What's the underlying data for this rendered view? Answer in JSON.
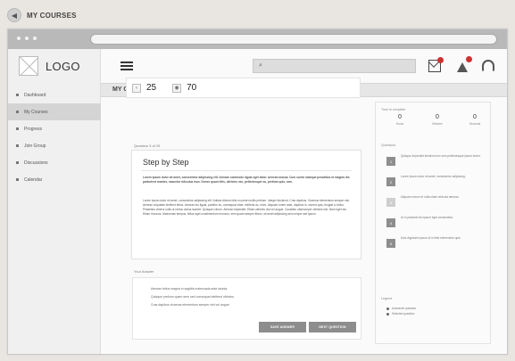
{
  "page": {
    "title": "MY COURSES"
  },
  "sidebar": {
    "logo": "LOGO",
    "items": [
      {
        "label": "Dashboard",
        "active": false
      },
      {
        "label": "My Courses",
        "active": true
      },
      {
        "label": "Progress",
        "active": false
      },
      {
        "label": "Join Group",
        "active": false
      },
      {
        "label": "Discussions",
        "active": false
      },
      {
        "label": "Calendar",
        "active": false
      }
    ]
  },
  "header": {
    "search_icon": "search-icon",
    "icons": [
      "mail-icon",
      "alert-icon",
      "headset-icon"
    ]
  },
  "section": {
    "title": "MY COURSES"
  },
  "stats": {
    "count": "25",
    "views": "70"
  },
  "question": {
    "label": "Question 3 of 25",
    "title": "Step by Step",
    "para1": "Lorem ipsum dolor sit amet, consectetur adipiscing elit. Aenean commodo ligula eget dolor. Aenean massa. Cum sociis natoque penatibus et magnis dis parturient montes, nascetur ridiculus mus. Donec quam felis, ultricies nec, pellentesque eu, pretium quis, sem.",
    "para2": "Lorem ipsum dolor sit amet, consectetur adipiscing elit. Nullam dictum felis eu pede mollis pretium. Integer tincidunt. Cras dapibus. Vivamus elementum semper nisi. Aenean vulputate eleifend tellus. Aenean leo ligula, porttitor eu, consequat vitae, eleifend ac, enim. Aliquam lorem ante, dapibus in, viverra quis, feugiat a, tellus. Phasellus viverra nulla ut metus varius laoreet. Quisque rutrum. Aenean imperdiet. Etiam ultricies nisi vel augue. Curabitur ullamcorper ultricies nisi. Nam eget dui. Etiam rhoncus. Maecenas tempus, tellus eget condimentum rhoncus, sem quam semper libero, sit amet adipiscing sem neque sed ipsum."
  },
  "answer": {
    "label": "Your Answer",
    "lines": [
      "Aenean tellus magna in sagittis malesuada ante lacinia.",
      "Quisque pretium quam sem sed consequat eleifend ultricies.",
      "Cras dapibus vivamus elementum semper nisi vel augue."
    ],
    "save_label": "SAVE ANSWER",
    "next_label": "NEXT QUESTION"
  },
  "right_panel": {
    "header": "Time to complete",
    "counters": [
      {
        "num": "0",
        "label": "Hours"
      },
      {
        "num": "0",
        "label": "Minutes"
      },
      {
        "num": "0",
        "label": "Seconds"
      }
    ],
    "questions_label": "Questions",
    "questions": [
      {
        "num": "1",
        "text": "Quisque imperdiet tincidunt nec sem pellentesque ipsum lorem.",
        "done": true
      },
      {
        "num": "2",
        "text": "Lorem ipsum dolor sit amet, consectetur adipiscing.",
        "done": true
      },
      {
        "num": "3",
        "text": "Aliquam rutrum et nulla vitae vehicula aenean.",
        "done": false
      },
      {
        "num": "4",
        "text": "Ut in placerat nisi ipsum eget consectetur.",
        "done": true
      },
      {
        "num": "5",
        "text": "Duis dignissim ipsum id in felis elementum quis.",
        "done": true
      }
    ],
    "legend_label": "Legend",
    "legend": [
      "Answered question",
      "Selected question"
    ]
  }
}
